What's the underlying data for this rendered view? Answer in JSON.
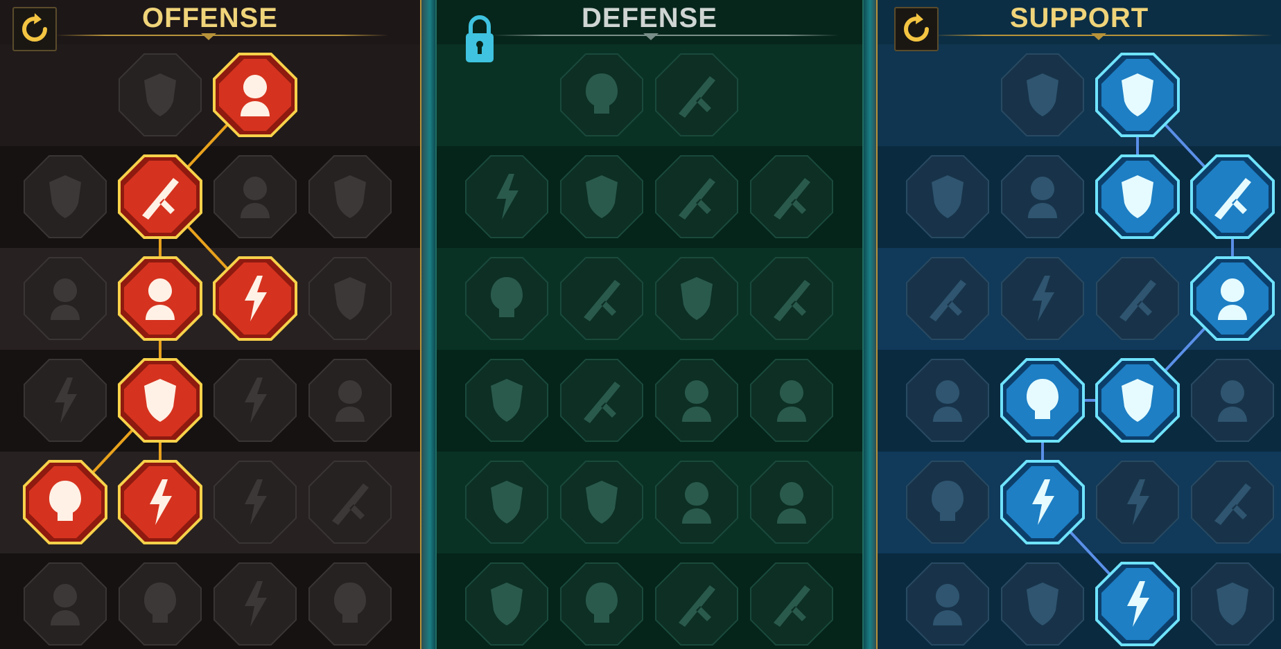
{
  "trees": {
    "offense": {
      "title": "OFFENSE",
      "accent": "#f4c542"
    },
    "defense": {
      "title": "DEFENSE",
      "accent": "#3fc3e0"
    },
    "support": {
      "title": "SUPPORT",
      "accent": "#4fb6ff"
    }
  },
  "icons": {
    "reset": "reset-arrow-icon",
    "lock": "padlock-icon"
  },
  "colors": {
    "offense_active_fill": "#d5331f",
    "offense_active_border": "#f7d14a",
    "support_active_fill": "#1e7fc4",
    "support_active_border": "#6fe3ff",
    "inactive_fill": "#2a2a2a",
    "link_offense": "#e8a21d",
    "link_support": "#5a8fe8"
  },
  "nodes": [
    {
      "id": "off-r1-c2",
      "tree": "offense",
      "row": 1,
      "col": 2,
      "icon": "crossed-swords-icon",
      "active": false
    },
    {
      "id": "off-r1-c3",
      "tree": "offense",
      "row": 1,
      "col": 3,
      "icon": "slashing-dagger-icon",
      "active": true
    },
    {
      "id": "off-r2-c1",
      "tree": "offense",
      "row": 2,
      "col": 1,
      "icon": "horned-warrior-heart-icon",
      "active": false
    },
    {
      "id": "off-r2-c2",
      "tree": "offense",
      "row": 2,
      "col": 2,
      "icon": "shattering-blade-icon",
      "active": true
    },
    {
      "id": "off-r2-c3",
      "tree": "offense",
      "row": 2,
      "col": 3,
      "icon": "cracked-shield-icon",
      "active": false
    },
    {
      "id": "off-r2-c4",
      "tree": "offense",
      "row": 2,
      "col": 4,
      "icon": "dripping-heart-icon",
      "active": false
    },
    {
      "id": "off-r3-c1",
      "tree": "offense",
      "row": 3,
      "col": 1,
      "icon": "arrow-struck-warrior-icon",
      "active": false
    },
    {
      "id": "off-r3-c2",
      "tree": "offense",
      "row": 3,
      "col": 2,
      "icon": "fanged-jaws-icon",
      "active": true
    },
    {
      "id": "off-r3-c3",
      "tree": "offense",
      "row": 3,
      "col": 3,
      "icon": "skull-slash-icon",
      "active": true
    },
    {
      "id": "off-r3-c4",
      "tree": "offense",
      "row": 3,
      "col": 4,
      "icon": "scythe-hand-icon",
      "active": false
    },
    {
      "id": "off-r4-c1",
      "tree": "offense",
      "row": 4,
      "col": 1,
      "icon": "bleeding-sword-icon",
      "active": false
    },
    {
      "id": "off-r4-c2",
      "tree": "offense",
      "row": 4,
      "col": 2,
      "icon": "skeletal-hand-sword-icon",
      "active": true
    },
    {
      "id": "off-r4-c3",
      "tree": "offense",
      "row": 4,
      "col": 3,
      "icon": "battle-axe-icon",
      "active": false
    },
    {
      "id": "off-r4-c4",
      "tree": "offense",
      "row": 4,
      "col": 4,
      "icon": "lightning-chain-icon",
      "active": false
    },
    {
      "id": "off-r5-c1",
      "tree": "offense",
      "row": 5,
      "col": 1,
      "icon": "triple-arrow-target-icon",
      "active": true
    },
    {
      "id": "off-r5-c2",
      "tree": "offense",
      "row": 5,
      "col": 2,
      "icon": "triple-skull-icon",
      "active": true
    },
    {
      "id": "off-r5-c3",
      "tree": "offense",
      "row": 5,
      "col": 3,
      "icon": "sword-arc-icon",
      "active": false
    },
    {
      "id": "off-r5-c4",
      "tree": "offense",
      "row": 5,
      "col": 4,
      "icon": "shocked-figure-icon",
      "active": false
    },
    {
      "id": "off-r6-c1",
      "tree": "offense",
      "row": 6,
      "col": 1,
      "icon": "sparkling-blade-icon",
      "active": false
    },
    {
      "id": "off-r6-c2",
      "tree": "offense",
      "row": 6,
      "col": 2,
      "icon": "knight-helmet-icon",
      "active": false
    },
    {
      "id": "off-r6-c3",
      "tree": "offense",
      "row": 6,
      "col": 3,
      "icon": "horned-giant-icon",
      "active": false
    },
    {
      "id": "off-r6-c4",
      "tree": "offense",
      "row": 6,
      "col": 4,
      "icon": "spiked-skull-icon",
      "active": false
    },
    {
      "id": "def-r1-c2",
      "tree": "defense",
      "row": 1,
      "col": 2,
      "icon": "armor-plates-icon",
      "active": false
    },
    {
      "id": "def-r1-c3",
      "tree": "defense",
      "row": 1,
      "col": 3,
      "icon": "raised-fist-icon",
      "active": false
    },
    {
      "id": "def-r2-c1",
      "tree": "defense",
      "row": 2,
      "col": 1,
      "icon": "cloak-shield-icon",
      "active": false
    },
    {
      "id": "def-r2-c2",
      "tree": "defense",
      "row": 2,
      "col": 2,
      "icon": "cracked-heart-vial-icon",
      "active": false
    },
    {
      "id": "def-r2-c3",
      "tree": "defense",
      "row": 2,
      "col": 3,
      "icon": "stone-golem-icon",
      "active": false
    },
    {
      "id": "def-r2-c4",
      "tree": "defense",
      "row": 2,
      "col": 4,
      "icon": "crossed-blades-icon",
      "active": false
    },
    {
      "id": "def-r3-c1",
      "tree": "defense",
      "row": 3,
      "col": 1,
      "icon": "parrying-figure-icon",
      "active": false
    },
    {
      "id": "def-r3-c2",
      "tree": "defense",
      "row": 3,
      "col": 2,
      "icon": "knight-shield-icon",
      "active": false
    },
    {
      "id": "def-r3-c3",
      "tree": "defense",
      "row": 3,
      "col": 3,
      "icon": "skull-heart-icon",
      "active": false
    },
    {
      "id": "def-r3-c4",
      "tree": "defense",
      "row": 3,
      "col": 4,
      "icon": "hooded-face-icon",
      "active": false
    },
    {
      "id": "def-r4-c1",
      "tree": "defense",
      "row": 4,
      "col": 1,
      "icon": "rallying-crowd-icon",
      "active": false
    },
    {
      "id": "def-r4-c2",
      "tree": "defense",
      "row": 4,
      "col": 2,
      "icon": "skull-hourglass-icon",
      "active": false
    },
    {
      "id": "def-r4-c3",
      "tree": "defense",
      "row": 4,
      "col": 3,
      "icon": "open-palm-icon",
      "active": false
    },
    {
      "id": "def-r4-c4",
      "tree": "defense",
      "row": 4,
      "col": 4,
      "icon": "bull-head-icon",
      "active": false
    },
    {
      "id": "def-r5-c1",
      "tree": "defense",
      "row": 5,
      "col": 1,
      "icon": "dashing-figure-icon",
      "active": false
    },
    {
      "id": "def-r5-c2",
      "tree": "defense",
      "row": 5,
      "col": 2,
      "icon": "blood-drops-icon",
      "active": false
    },
    {
      "id": "def-r5-c3",
      "tree": "defense",
      "row": 5,
      "col": 3,
      "icon": "crowned-skull-icon",
      "active": false
    },
    {
      "id": "def-r5-c4",
      "tree": "defense",
      "row": 5,
      "col": 4,
      "icon": "deflect-arrow-icon",
      "active": false
    },
    {
      "id": "def-r6-c1",
      "tree": "defense",
      "row": 6,
      "col": 1,
      "icon": "flaming-warrior-icon",
      "active": false
    },
    {
      "id": "def-r6-c2",
      "tree": "defense",
      "row": 6,
      "col": 2,
      "icon": "winged-shield-icon",
      "active": false
    },
    {
      "id": "def-r6-c3",
      "tree": "defense",
      "row": 6,
      "col": 3,
      "icon": "bearded-face-icon",
      "active": false
    },
    {
      "id": "def-r6-c4",
      "tree": "defense",
      "row": 6,
      "col": 4,
      "icon": "muscular-figure-icon",
      "active": false
    },
    {
      "id": "sup-r1-c2",
      "tree": "support",
      "row": 1,
      "col": 2,
      "icon": "heart-plus-icon",
      "active": false
    },
    {
      "id": "sup-r1-c3",
      "tree": "support",
      "row": 1,
      "col": 3,
      "icon": "swirling-orb-icon",
      "active": true
    },
    {
      "id": "sup-r2-c1",
      "tree": "support",
      "row": 2,
      "col": 1,
      "icon": "praying-hands-icon",
      "active": false
    },
    {
      "id": "sup-r2-c2",
      "tree": "support",
      "row": 2,
      "col": 2,
      "icon": "radiating-shield-icon",
      "active": false
    },
    {
      "id": "sup-r2-c3",
      "tree": "support",
      "row": 2,
      "col": 3,
      "icon": "flaming-skull-icon",
      "active": true
    },
    {
      "id": "sup-r2-c4",
      "tree": "support",
      "row": 2,
      "col": 4,
      "icon": "shattered-blade-icon",
      "active": true
    },
    {
      "id": "sup-r3-c1",
      "tree": "support",
      "row": 3,
      "col": 1,
      "icon": "blessed-figure-icon",
      "active": false
    },
    {
      "id": "sup-r3-c2",
      "tree": "support",
      "row": 3,
      "col": 2,
      "icon": "lightning-shield-icon",
      "active": false
    },
    {
      "id": "sup-r3-c3",
      "tree": "support",
      "row": 3,
      "col": 3,
      "icon": "crackling-bolt-icon",
      "active": false
    },
    {
      "id": "sup-r3-c4",
      "tree": "support",
      "row": 3,
      "col": 4,
      "icon": "afterimage-figure-icon",
      "active": true
    },
    {
      "id": "sup-r4-c1",
      "tree": "support",
      "row": 4,
      "col": 1,
      "icon": "chained-heart-icon",
      "active": false
    },
    {
      "id": "sup-r4-c2",
      "tree": "support",
      "row": 4,
      "col": 2,
      "icon": "comet-icon",
      "active": true
    },
    {
      "id": "sup-r4-c3",
      "tree": "support",
      "row": 4,
      "col": 3,
      "icon": "open-book-icon",
      "active": true
    },
    {
      "id": "sup-r4-c4",
      "tree": "support",
      "row": 4,
      "col": 4,
      "icon": "fierce-eyes-icon",
      "active": false
    },
    {
      "id": "sup-r5-c1",
      "tree": "support",
      "row": 5,
      "col": 1,
      "icon": "compass-star-icon",
      "active": false
    },
    {
      "id": "sup-r5-c2",
      "tree": "support",
      "row": 5,
      "col": 2,
      "icon": "winged-boot-icon",
      "active": true
    },
    {
      "id": "sup-r5-c3",
      "tree": "support",
      "row": 5,
      "col": 3,
      "icon": "all-seeing-eye-icon",
      "active": false
    },
    {
      "id": "sup-r5-c4",
      "tree": "support",
      "row": 5,
      "col": 4,
      "icon": "pierced-figure-icon",
      "active": false
    },
    {
      "id": "sup-r6-c1",
      "tree": "support",
      "row": 6,
      "col": 1,
      "icon": "poison-flask-icon",
      "active": false
    },
    {
      "id": "sup-r6-c2",
      "tree": "support",
      "row": 6,
      "col": 2,
      "icon": "skull-wings-icon",
      "active": false
    },
    {
      "id": "sup-r6-c3",
      "tree": "support",
      "row": 6,
      "col": 3,
      "icon": "fist-shockwave-icon",
      "active": true
    },
    {
      "id": "sup-r6-c4",
      "tree": "support",
      "row": 6,
      "col": 4,
      "icon": "eagle-head-icon",
      "active": false
    }
  ],
  "links": [
    {
      "from": "off-r1-c3",
      "to": "off-r2-c2",
      "tree": "offense"
    },
    {
      "from": "off-r2-c2",
      "to": "off-r3-c2",
      "tree": "offense"
    },
    {
      "from": "off-r2-c2",
      "to": "off-r3-c3",
      "tree": "offense"
    },
    {
      "from": "off-r3-c2",
      "to": "off-r4-c2",
      "tree": "offense"
    },
    {
      "from": "off-r4-c2",
      "to": "off-r5-c1",
      "tree": "offense"
    },
    {
      "from": "off-r4-c2",
      "to": "off-r5-c2",
      "tree": "offense"
    },
    {
      "from": "sup-r1-c3",
      "to": "sup-r2-c3",
      "tree": "support"
    },
    {
      "from": "sup-r1-c3",
      "to": "sup-r2-c4",
      "tree": "support"
    },
    {
      "from": "sup-r2-c4",
      "to": "sup-r3-c4",
      "tree": "support"
    },
    {
      "from": "sup-r3-c4",
      "to": "sup-r4-c3",
      "tree": "support"
    },
    {
      "from": "sup-r4-c3",
      "to": "sup-r4-c2",
      "tree": "support"
    },
    {
      "from": "sup-r4-c2",
      "to": "sup-r5-c2",
      "tree": "support"
    },
    {
      "from": "sup-r5-c2",
      "to": "sup-r6-c3",
      "tree": "support"
    }
  ]
}
